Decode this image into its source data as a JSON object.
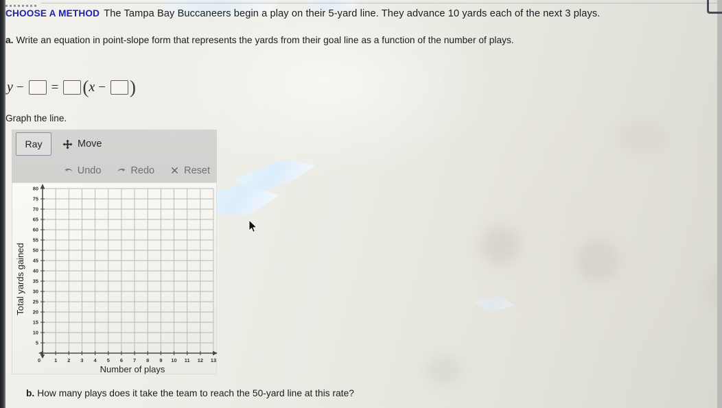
{
  "prompt": {
    "method_tag": "CHOOSE A METHOD",
    "body": "The Tampa Bay Buccaneers begin a play on their 5-yard line. They advance 10 yards each of the next 3 plays."
  },
  "part_a": {
    "label": "a.",
    "text": "Write an equation in point-slope form that represents the yards from their goal line as a function of the number of plays."
  },
  "equation": {
    "y": "y",
    "minus1": "−",
    "box1": "",
    "equals": "=",
    "box2": "",
    "open_paren": "(",
    "x": "x",
    "minus2": "−",
    "box3": "",
    "close_paren": ")"
  },
  "graph_instruction": "Graph the line.",
  "toolbar": {
    "ray_label": "Ray",
    "move_label": "Move",
    "undo_label": "Undo",
    "redo_label": "Redo",
    "reset_label": "Reset",
    "ray_selected": true
  },
  "part_b": {
    "label": "b.",
    "text": "How many plays does it take the team to reach the 50-yard line at this rate?"
  },
  "colors": {
    "method_tag": "#2021a8",
    "text": "#1b1c1e",
    "toolbar_bg": "#d2d3d0",
    "grid": "#b6b8b4",
    "axis": "#4a4c4f",
    "muted_button": "#6d7074"
  },
  "chart_data": {
    "type": "line",
    "title": "",
    "xlabel": "Number of plays",
    "ylabel": "Total yards gained",
    "xlim": [
      0,
      13
    ],
    "ylim": [
      0,
      80
    ],
    "x_ticks": [
      0,
      1,
      2,
      3,
      4,
      5,
      6,
      7,
      8,
      9,
      10,
      11,
      12,
      13
    ],
    "y_ticks": [
      0,
      5,
      10,
      15,
      20,
      25,
      30,
      35,
      40,
      45,
      50,
      55,
      60,
      65,
      70,
      75,
      80
    ],
    "x_tick_labels": [
      "0",
      "1",
      "2",
      "3",
      "4",
      "5",
      "6",
      "7",
      "8",
      "9",
      "10",
      "11",
      "12",
      "13"
    ],
    "y_tick_labels": [
      "0",
      "5",
      "10",
      "15",
      "20",
      "25",
      "30",
      "35",
      "40",
      "45",
      "50",
      "55",
      "60",
      "65",
      "70",
      "75",
      "80"
    ],
    "grid": true,
    "legend": null,
    "series": [],
    "annotations": []
  }
}
